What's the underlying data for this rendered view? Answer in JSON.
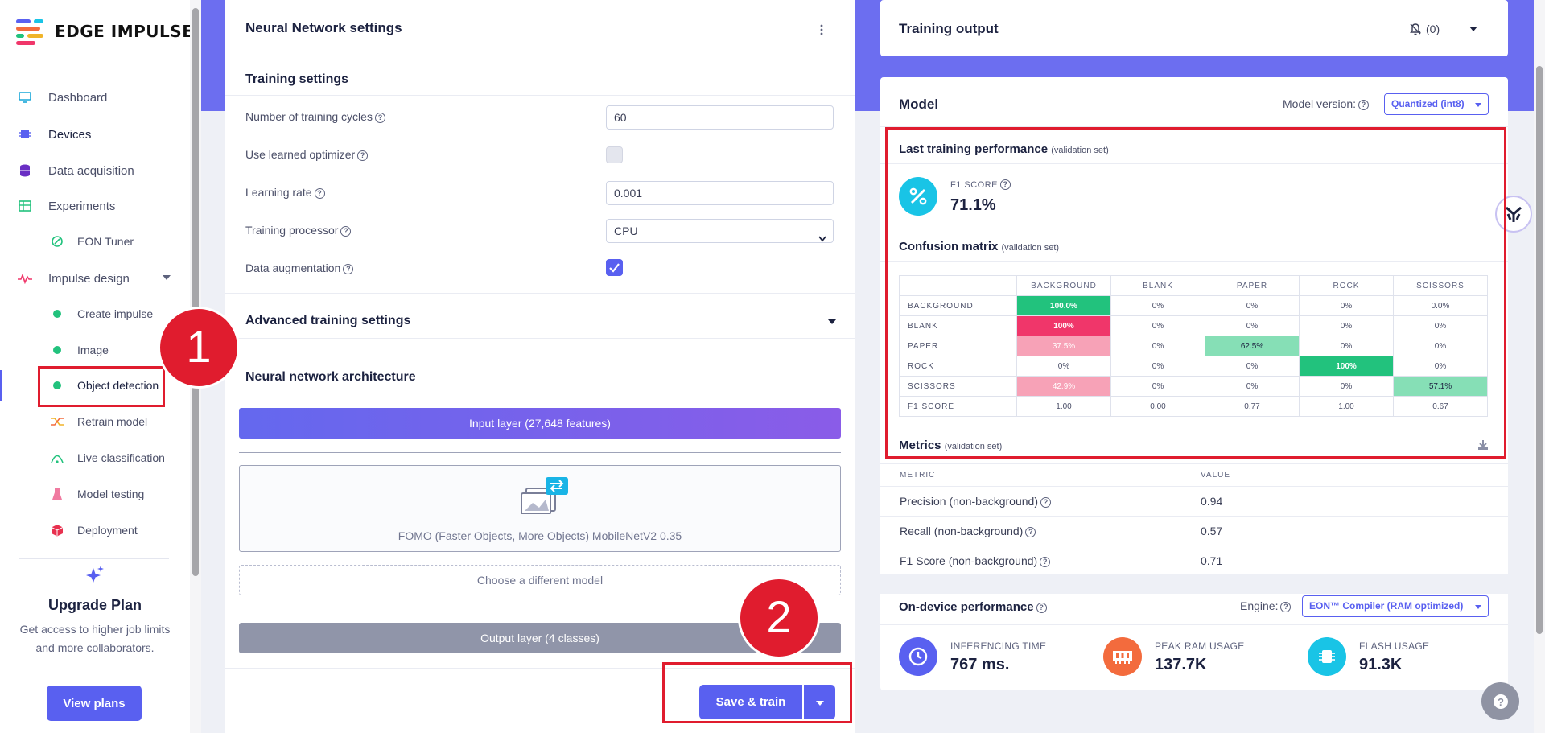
{
  "app": {
    "logo_text": "EDGE IMPULSE"
  },
  "sidebar": {
    "items": [
      {
        "label": "Dashboard",
        "icon": "monitor-icon"
      },
      {
        "label": "Devices",
        "icon": "chip-icon"
      },
      {
        "label": "Data acquisition",
        "icon": "database-icon"
      },
      {
        "label": "Experiments",
        "icon": "table-icon"
      },
      {
        "label": "EON Tuner",
        "icon": "tuner-icon"
      },
      {
        "label": "Impulse design",
        "icon": "pulse-icon"
      },
      {
        "label": "Create impulse",
        "icon": "dot-icon"
      },
      {
        "label": "Image",
        "icon": "dot-icon"
      },
      {
        "label": "Object detection",
        "icon": "dot-icon"
      },
      {
        "label": "Retrain model",
        "icon": "shuffle-icon"
      },
      {
        "label": "Live classification",
        "icon": "signal-icon"
      },
      {
        "label": "Model testing",
        "icon": "flask-icon"
      },
      {
        "label": "Deployment",
        "icon": "cube-icon"
      }
    ],
    "upgrade": {
      "title": "Upgrade Plan",
      "description": "Get access to higher job limits and more collaborators.",
      "button": "View plans"
    }
  },
  "nn_settings": {
    "title": "Neural Network settings",
    "training_settings_title": "Training settings",
    "cycles_label": "Number of training cycles",
    "cycles_value": "60",
    "optimizer_label": "Use learned optimizer",
    "optimizer_checked": false,
    "lr_label": "Learning rate",
    "lr_value": "0.001",
    "processor_label": "Training processor",
    "processor_value": "CPU",
    "augmentation_label": "Data augmentation",
    "augmentation_checked": true,
    "advanced_title": "Advanced training settings",
    "architecture_title": "Neural network architecture",
    "input_layer": "Input layer (27,648 features)",
    "model_name": "FOMO (Faster Objects, More Objects) MobileNetV2 0.35",
    "choose_model": "Choose a different model",
    "output_layer": "Output layer (4 classes)",
    "save_button": "Save & train"
  },
  "training_output": {
    "title": "Training output",
    "notifications": "(0)"
  },
  "model": {
    "title": "Model",
    "version_label": "Model version:",
    "version_value": "Quantized (int8)",
    "last_perf_title": "Last training performance",
    "validation_note": "(validation set)",
    "f1_label": "F1 SCORE",
    "f1_value": "71.1%",
    "confusion_title": "Confusion matrix",
    "confusion": {
      "columns": [
        "BACKGROUND",
        "BLANK",
        "PAPER",
        "ROCK",
        "SCISSORS"
      ],
      "rows": [
        {
          "label": "BACKGROUND",
          "cells": [
            "100.0%",
            "0%",
            "0%",
            "0%",
            "0.0%"
          ]
        },
        {
          "label": "BLANK",
          "cells": [
            "100%",
            "0%",
            "0%",
            "0%",
            "0%"
          ]
        },
        {
          "label": "PAPER",
          "cells": [
            "37.5%",
            "0%",
            "62.5%",
            "0%",
            "0%"
          ]
        },
        {
          "label": "ROCK",
          "cells": [
            "0%",
            "0%",
            "0%",
            "100%",
            "0%"
          ]
        },
        {
          "label": "SCISSORS",
          "cells": [
            "42.9%",
            "0%",
            "0%",
            "0%",
            "57.1%"
          ]
        },
        {
          "label": "F1 SCORE",
          "cells": [
            "1.00",
            "0.00",
            "0.77",
            "1.00",
            "0.67"
          ]
        }
      ],
      "colors": {
        "green_strong": "#22c27d",
        "green_light": "#86dfb6",
        "red_strong": "#f0366a",
        "red_light": "#f7a2b7"
      }
    },
    "metrics_title": "Metrics",
    "metrics_header": [
      "METRIC",
      "VALUE"
    ],
    "metrics": [
      {
        "name": "Precision (non-background)",
        "value": "0.94"
      },
      {
        "name": "Recall (non-background)",
        "value": "0.57"
      },
      {
        "name": "F1 Score (non-background)",
        "value": "0.71"
      }
    ],
    "on_device_title": "On-device performance",
    "engine_label": "Engine:",
    "engine_value": "EON™ Compiler (RAM optimized)",
    "perf": [
      {
        "label": "INFERENCING TIME",
        "value": "767 ms.",
        "color": "#5960f0"
      },
      {
        "label": "PEAK RAM USAGE",
        "value": "137.7K",
        "color": "#f36b3d"
      },
      {
        "label": "FLASH USAGE",
        "value": "91.3K",
        "color": "#19c4e6"
      }
    ]
  },
  "annotations": {
    "badge_1": "1",
    "badge_2": "2"
  },
  "colors": {
    "accent": "#5960f0",
    "highlight": "#e01c2e"
  }
}
